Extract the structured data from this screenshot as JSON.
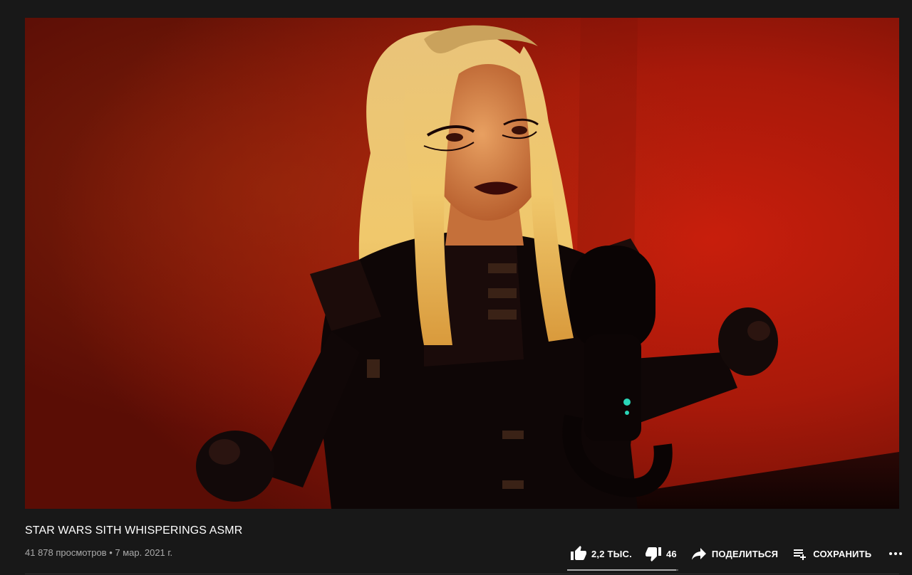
{
  "video": {
    "title": "STAR WARS SITH WHISPERINGS ASMR",
    "views": "41 878 просмотров",
    "separator": "•",
    "date": "7 мар. 2021 г."
  },
  "actions": {
    "like_count": "2,2 ТЫС.",
    "dislike_count": "46",
    "share_label": "ПОДЕЛИТЬСЯ",
    "save_label": "СОХРАНИТЬ"
  },
  "sentiment": {
    "like_fraction": 0.98
  },
  "icons": {
    "like": "thumb-up-icon",
    "dislike": "thumb-down-icon",
    "share": "share-arrow-icon",
    "save": "playlist-add-icon",
    "more": "more-horizontal-icon"
  },
  "colors": {
    "background": "#181818",
    "text_primary": "#ffffff",
    "text_secondary": "#aaaaaa",
    "video_dominant": "#b4180a"
  }
}
